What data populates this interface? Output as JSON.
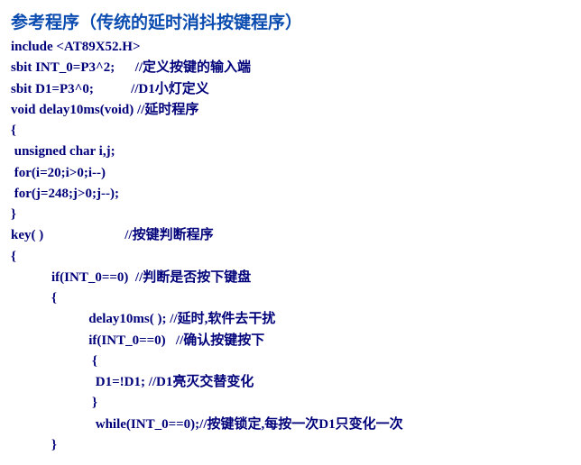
{
  "title": "参考程序（传统的延时消抖按键程序）",
  "code": {
    "l1": "include <AT89X52.H>",
    "l2": "sbit INT_0=P3^2;      //定义按键的输入端",
    "l3": "sbit D1=P3^0;           //D1小灯定义",
    "l4": "void delay10ms(void) //延时程序",
    "l5": "{",
    "l6": " unsigned char i,j;",
    "l7": " for(i=20;i>0;i--)",
    "l8": " for(j=248;j>0;j--);",
    "l9": "}",
    "l10": "key( )                        //按键判断程序",
    "l11": "{",
    "l12": "            if(INT_0==0)  //判断是否按下键盘",
    "l13": "            {",
    "l14": "                       delay10ms( ); //延时,软件去干扰",
    "l15": "                       if(INT_0==0)   //确认按键按下",
    "l16": "                        {",
    "l17": "                         D1=!D1; //D1亮灭交替变化",
    "l18": "                        }",
    "l19": "                         while(INT_0==0);//按键锁定,每按一次D1只变化一次",
    "l20": "            }"
  }
}
